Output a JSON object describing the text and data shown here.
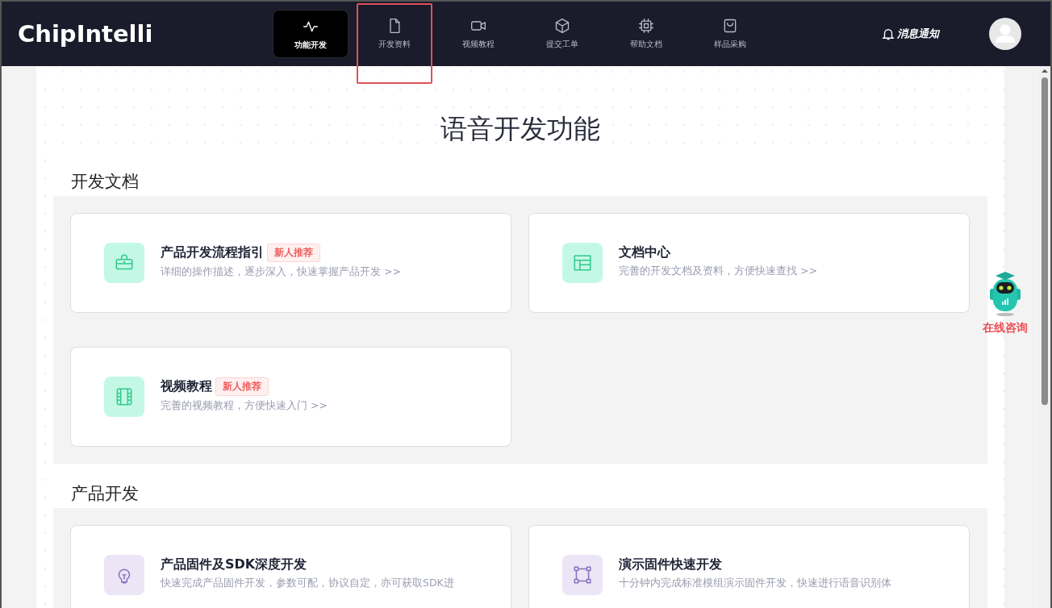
{
  "header": {
    "logo": "ChipIntelli",
    "nav": [
      {
        "label": "功能开发",
        "kind": "pulse",
        "selected": true,
        "highlighted": false
      },
      {
        "label": "开发资料",
        "kind": "file",
        "selected": false,
        "highlighted": true
      },
      {
        "label": "视频教程",
        "kind": "video",
        "selected": false,
        "highlighted": false
      },
      {
        "label": "提交工单",
        "kind": "cube",
        "selected": false,
        "highlighted": false
      },
      {
        "label": "帮助文档",
        "kind": "chip",
        "selected": false,
        "highlighted": false
      },
      {
        "label": "样品采购",
        "kind": "bag",
        "selected": false,
        "highlighted": false
      }
    ],
    "notification": "消息通知"
  },
  "page_title": "语音开发功能",
  "sections": [
    {
      "heading": "开发文档",
      "cards": [
        {
          "title": "产品开发流程指引",
          "badge": "新人推荐",
          "description": "详细的操作描述，逐步深入，快速掌握产品开发 >>",
          "kind": "briefcase",
          "color": "#c4f8e6"
        },
        {
          "title": "文档中心",
          "description": "完善的开发文档及资料，方便快速查找 >>",
          "kind": "layout",
          "color": "#c4f8e6"
        },
        {
          "title": "视频教程",
          "badge": "新人推荐",
          "description": "完善的视频教程，方便快速入门 >>",
          "kind": "film",
          "color": "#c4f8e6"
        }
      ]
    },
    {
      "heading": "产品开发",
      "cards": [
        {
          "title": "产品固件及SDK深度开发",
          "description": "快速完成产品固件开发，参数可配，协议自定，亦可获取SDK进",
          "kind": "bulb",
          "color": "#ebe5f5"
        },
        {
          "title": "演示固件快速开发",
          "description": "十分钟内完成标准模组演示固件开发，快速进行语音识别体",
          "kind": "frame",
          "color": "#ebe5f5"
        }
      ]
    }
  ],
  "online_help": "在线咨询"
}
